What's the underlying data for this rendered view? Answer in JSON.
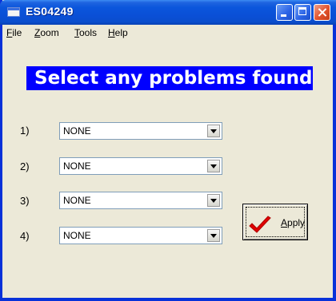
{
  "window": {
    "title": "ES04249"
  },
  "menu": [
    {
      "label": "File",
      "ul": "F",
      "rest": "ile"
    },
    {
      "label": "Zoom",
      "ul": "Z",
      "rest": "oom"
    },
    {
      "label": "Tools",
      "ul": "T",
      "rest": "ools"
    },
    {
      "label": "Help",
      "ul": "H",
      "rest": "elp"
    }
  ],
  "heading": "Select any problems found",
  "problems": [
    {
      "label": "1)",
      "value": "NONE"
    },
    {
      "label": "2)",
      "value": "NONE"
    },
    {
      "label": "3)",
      "value": "NONE"
    },
    {
      "label": "4)",
      "value": "NONE"
    }
  ],
  "apply": {
    "label": "Apply",
    "ul": "A",
    "rest": "pply",
    "icon": "red-checkmark-icon",
    "icon_color": "#e00000"
  },
  "colors": {
    "title_bar": "#0a4fd6",
    "heading_bg": "#0000ff",
    "heading_text": "#ffffff",
    "window_bg": "#ece9d8"
  }
}
